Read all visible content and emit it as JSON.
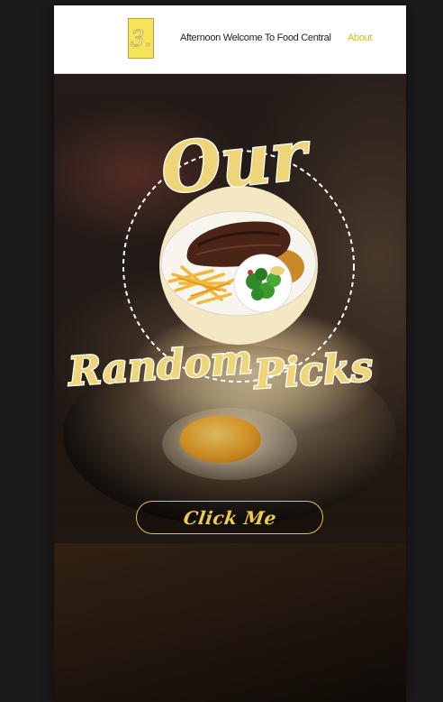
{
  "header": {
    "logo_text": "3.",
    "greeting": "Afternoon Welcome To Food Central",
    "nav_about": "About"
  },
  "hero": {
    "badge_word_top": "Our",
    "badge_word_left": "Random",
    "badge_word_right": "Picks",
    "button_label": "Click Me"
  },
  "colors": {
    "accent_gold": "#e6c14a",
    "nav_link": "#d8b431",
    "logo_bg": "#f5e35a",
    "plate_bg": "#f4e7c4"
  },
  "icons": {
    "logo": "logo-icon",
    "dish": "steak-fries-salad-plate-icon"
  }
}
